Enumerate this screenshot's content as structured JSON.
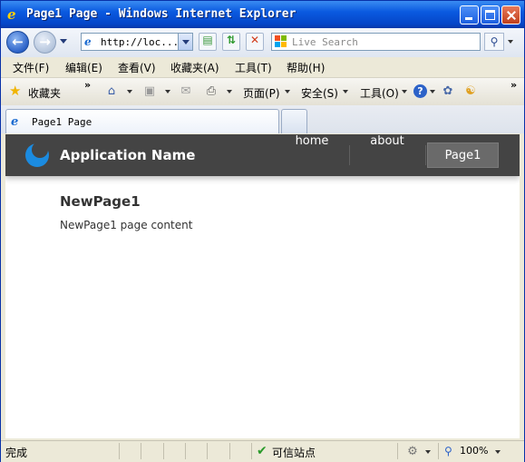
{
  "window": {
    "title": "Page1 Page - Windows Internet Explorer"
  },
  "address_bar": {
    "url": "http://loc..."
  },
  "search": {
    "placeholder": "Live Search"
  },
  "menu": {
    "items": [
      "文件(F)",
      "编辑(E)",
      "查看(V)",
      "收藏夹(A)",
      "工具(T)",
      "帮助(H)"
    ]
  },
  "command_bar": {
    "favorites_label": "收藏夹",
    "page_label": "页面(P)",
    "safety_label": "安全(S)",
    "tools_label": "工具(O)"
  },
  "tab": {
    "title": "Page1 Page"
  },
  "app": {
    "name": "Application Name",
    "nav": [
      "home",
      "about",
      "Page1"
    ],
    "active_nav": "Page1",
    "brand_color": "#1b8be0",
    "header_color": "#444444"
  },
  "page": {
    "title": "NewPage1",
    "body": "NewPage1 page content"
  },
  "status_bar": {
    "status": "完成",
    "zone": "可信站点",
    "zoom": "100%"
  }
}
